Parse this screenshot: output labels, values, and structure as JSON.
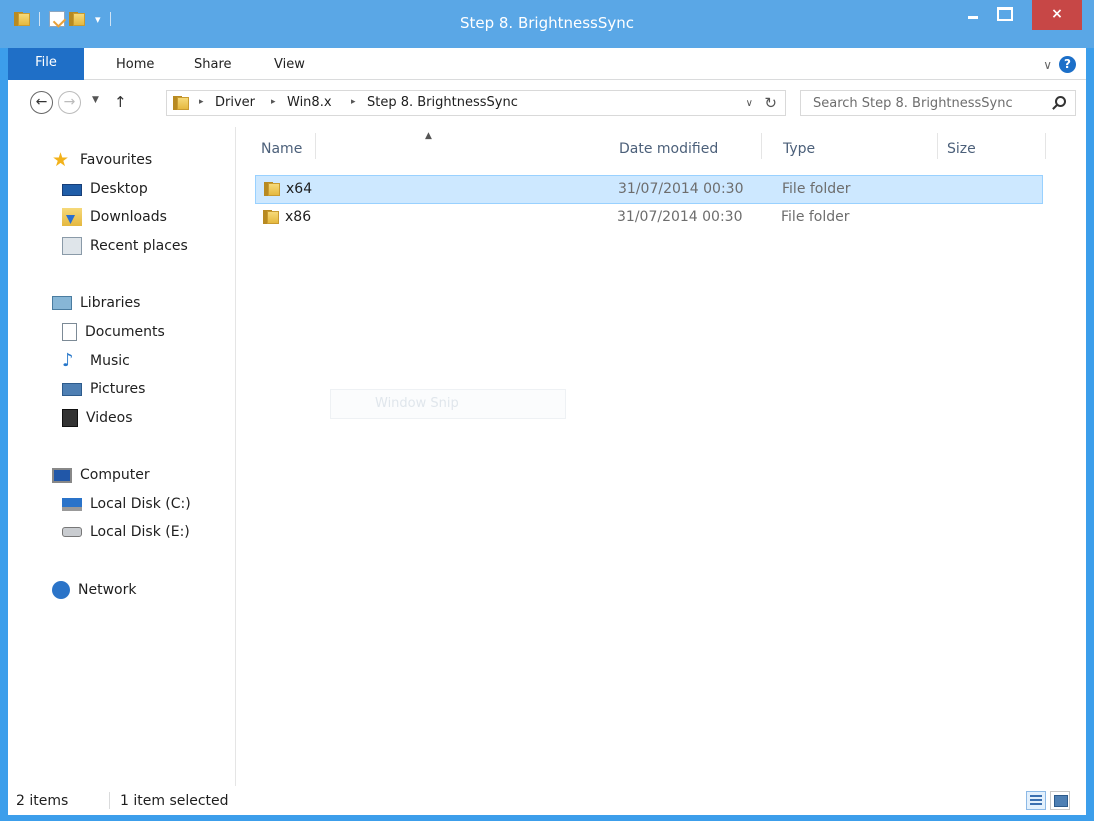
{
  "window": {
    "title": "Step 8. BrightnessSync",
    "close_glyph": "×"
  },
  "ribbon": {
    "tabs": [
      "File",
      "Home",
      "Share",
      "View"
    ]
  },
  "address": {
    "crumbs": [
      "Driver",
      "Win8.x",
      "Step 8. BrightnessSync"
    ],
    "search_placeholder": "Search Step 8. BrightnessSync"
  },
  "sidebar": {
    "favourites": {
      "label": "Favourites",
      "items": [
        {
          "label": "Desktop",
          "icon": "desktop-icon"
        },
        {
          "label": "Downloads",
          "icon": "downloads-icon"
        },
        {
          "label": "Recent places",
          "icon": "recent-places-icon"
        }
      ]
    },
    "libraries": {
      "label": "Libraries",
      "items": [
        {
          "label": "Documents",
          "icon": "documents-icon"
        },
        {
          "label": "Music",
          "icon": "music-icon"
        },
        {
          "label": "Pictures",
          "icon": "pictures-icon"
        },
        {
          "label": "Videos",
          "icon": "videos-icon"
        }
      ]
    },
    "computer": {
      "label": "Computer",
      "items": [
        {
          "label": "Local Disk (C:)",
          "icon": "local-disk-c-icon"
        },
        {
          "label": "Local Disk (E:)",
          "icon": "local-disk-e-icon"
        }
      ]
    },
    "network": {
      "label": "Network"
    }
  },
  "file_list": {
    "columns": [
      "Name",
      "Date modified",
      "Type",
      "Size"
    ],
    "rows": [
      {
        "name": "x64",
        "date": "31/07/2014 00:30",
        "type": "File folder",
        "size": "",
        "selected": true
      },
      {
        "name": "x86",
        "date": "31/07/2014 00:30",
        "type": "File folder",
        "size": "",
        "selected": false
      }
    ]
  },
  "overlay": {
    "text": "Window Snip"
  },
  "status": {
    "count": "2 items",
    "selection": "1 item selected"
  },
  "colors": {
    "titlebar": "#5aa7e6",
    "file_tab": "#1f6fc7",
    "close_button": "#c74746",
    "selection": "#cde8ff"
  }
}
